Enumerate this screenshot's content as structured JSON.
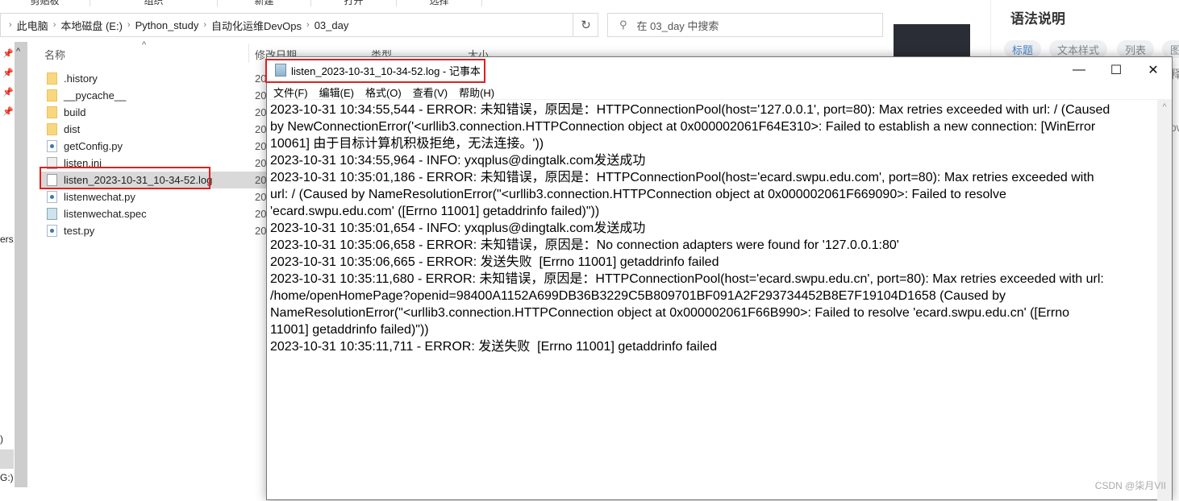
{
  "explorer": {
    "ribbon": [
      "剪贴板",
      "组织",
      "新建",
      "打开",
      "选择"
    ],
    "breadcrumb": [
      "此电脑",
      "本地磁盘 (E:)",
      "Python_study",
      "自动化运维DevOps",
      "03_day"
    ],
    "search_placeholder": "在 03_day 中搜索",
    "columns": {
      "name": "名称",
      "date": "修改日期",
      "type": "类型",
      "size": "大小"
    },
    "files": [
      {
        "name": ".history",
        "kind": "folder"
      },
      {
        "name": "__pycache__",
        "kind": "folder"
      },
      {
        "name": "build",
        "kind": "folder"
      },
      {
        "name": "dist",
        "kind": "folder"
      },
      {
        "name": "getConfig.py",
        "kind": "py"
      },
      {
        "name": "listen.ini",
        "kind": "ini"
      },
      {
        "name": "listen_2023-10-31_10-34-52.log",
        "kind": "log",
        "selected": true
      },
      {
        "name": "listenwechat.py",
        "kind": "py"
      },
      {
        "name": "listenwechat.spec",
        "kind": "spec"
      },
      {
        "name": "test.py",
        "kind": "py"
      }
    ],
    "date_prefix": "20",
    "nav_fragments": [
      "ers",
      ")",
      "G:)"
    ]
  },
  "notepad": {
    "title": "listen_2023-10-31_10-34-52.log - 记事本",
    "menu": [
      "文件(F)",
      "编辑(E)",
      "格式(O)",
      "查看(V)",
      "帮助(H)"
    ],
    "lines": [
      "2023-10-31 10:34:55,544 - ERROR: 未知错误，原因是：HTTPConnectionPool(host='127.0.0.1', port=80): Max retries exceeded with url: / (Caused",
      "by NewConnectionError('<urllib3.connection.HTTPConnection object at 0x000002061F64E310>: Failed to establish a new connection: [WinError",
      "10061] 由于目标计算机积极拒绝，无法连接。'))",
      "2023-10-31 10:34:55,964 - INFO: yxqplus@dingtalk.com发送成功",
      "2023-10-31 10:35:01,186 - ERROR: 未知错误，原因是：HTTPConnectionPool(host='ecard.swpu.edu.com', port=80): Max retries exceeded with",
      "url: / (Caused by NameResolutionError(\"<urllib3.connection.HTTPConnection object at 0x000002061F669090>: Failed to resolve",
      "'ecard.swpu.edu.com' ([Errno 11001] getaddrinfo failed)\"))",
      "2023-10-31 10:35:01,654 - INFO: yxqplus@dingtalk.com发送成功",
      "2023-10-31 10:35:06,658 - ERROR: 未知错误，原因是：No connection adapters were found for '127.0.0.1:80'",
      "2023-10-31 10:35:06,665 - ERROR: 发送失败  [Errno 11001] getaddrinfo failed",
      "2023-10-31 10:35:11,680 - ERROR: 未知错误，原因是：HTTPConnectionPool(host='ecard.swpu.edu.cn', port=80): Max retries exceeded with url:",
      "/home/openHomePage?openid=98400A1152A699DB36B3229C5B809701BF091A2F293734452B8E7F19104D1658 (Caused by",
      "NameResolutionError(\"<urllib3.connection.HTTPConnection object at 0x000002061F66B990>: Failed to resolve 'ecard.swpu.edu.cn' ([Errno",
      "11001] getaddrinfo failed)\"))",
      "2023-10-31 10:35:11,711 - ERROR: 发送失败  [Errno 11001] getaddrinfo failed"
    ]
  },
  "right_panel": {
    "title": "语法说明",
    "chips": [
      "标题",
      "文本样式",
      "列表",
      "图"
    ],
    "fragments": [
      "释",
      "ow"
    ]
  },
  "watermark": "CSDN @柒月VII",
  "colors": {
    "highlight_box": "#e02020",
    "active_chip": "#4a86c8"
  }
}
